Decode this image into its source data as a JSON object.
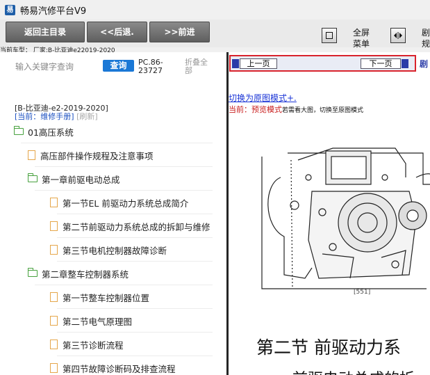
{
  "window": {
    "title": "畅易汽修平台V9"
  },
  "toolbar": {
    "home": "返回主目录",
    "back": "<<后退.",
    "forward": ">>前进",
    "fullscreen": [
      "全屏",
      "菜单"
    ],
    "cut_label": [
      "剧",
      "规"
    ]
  },
  "vehicle_line": "当前车型：  厂家:B-比亚迪e22019-2020",
  "search": {
    "placeholder": "输入关键字查询",
    "button": "查询",
    "code": "PC.86-23727",
    "fold_all": "折叠全部"
  },
  "breadcrumb": {
    "title": "[B-比亚迪-e2-2019-2020]",
    "current": "[当前：维修手册]",
    "refresh": "[刷新]"
  },
  "tree": [
    {
      "label": "01高压系统",
      "type": "folder",
      "level": 0
    },
    {
      "label": "高压部件操作规程及注意事项",
      "type": "doc",
      "level": 1
    },
    {
      "label": "第一章前驱电动总成",
      "type": "folder",
      "level": 1
    },
    {
      "label": "第一节EL 前驱动力系统总成简介",
      "type": "doc",
      "level": 2
    },
    {
      "label": "第二节前驱动力系统总成的拆卸与维修",
      "type": "doc",
      "level": 2
    },
    {
      "label": "第三节电机控制器故障诊断",
      "type": "doc",
      "level": 2
    },
    {
      "label": "第二章整车控制器系统",
      "type": "folder",
      "level": 1
    },
    {
      "label": "第一节整车控制器位置",
      "type": "doc",
      "level": 2
    },
    {
      "label": "第二节电气原理图",
      "type": "doc",
      "level": 2
    },
    {
      "label": "第三节诊断流程",
      "type": "doc",
      "level": 2
    },
    {
      "label": "第四节故障诊断码及排查流程",
      "type": "doc",
      "level": 2
    }
  ],
  "pager": {
    "prev": "上一页",
    "next": "下一页",
    "cut": "剧"
  },
  "content": {
    "switch_link": "切换为原图模式+.",
    "mode_prefix": "当前：",
    "mode_name": "预览模式",
    "mode_hint": "若需看大图，切换至原图模式",
    "figure_label": "[551]",
    "section_title": "第二节 前驱动力系",
    "section_sub": "前驱电动总成的拆"
  },
  "colors": {
    "accent_blue": "#1a78d6",
    "highlight_red": "#d9232d",
    "folder_green": "#47a13e",
    "doc_orange": "#e5a64a"
  }
}
